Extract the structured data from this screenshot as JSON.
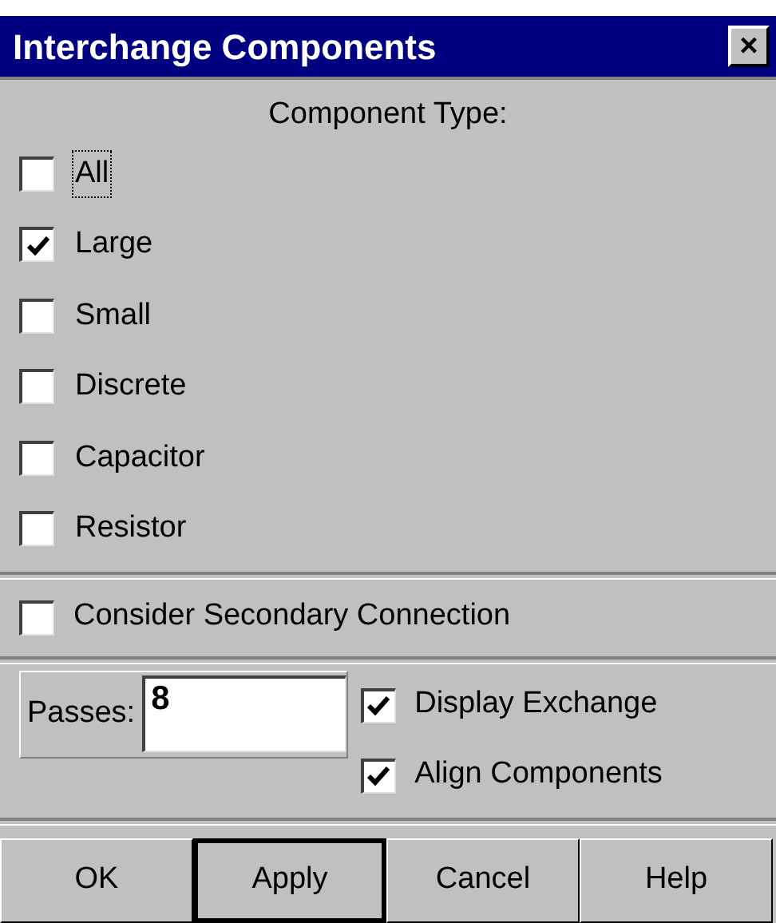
{
  "window": {
    "title": "Interchange Components",
    "close": "×"
  },
  "component_type": {
    "heading": "Component Type:",
    "items": [
      {
        "label": "All",
        "checked": false,
        "focused": true
      },
      {
        "label": "Large",
        "checked": true,
        "focused": false
      },
      {
        "label": "Small",
        "checked": false,
        "focused": false
      },
      {
        "label": "Discrete",
        "checked": false,
        "focused": false
      },
      {
        "label": "Capacitor",
        "checked": false,
        "focused": false
      },
      {
        "label": "Resistor",
        "checked": false,
        "focused": false
      }
    ]
  },
  "secondary": {
    "label": "Consider Secondary Connection",
    "checked": false
  },
  "passes": {
    "label": "Passes:",
    "value": "8"
  },
  "options": [
    {
      "label": "Display Exchange",
      "checked": true
    },
    {
      "label": "Align Components",
      "checked": true
    }
  ],
  "buttons": [
    {
      "label": "OK",
      "default": false
    },
    {
      "label": "Apply",
      "default": true
    },
    {
      "label": "Cancel",
      "default": false
    },
    {
      "label": "Help",
      "default": false
    }
  ]
}
